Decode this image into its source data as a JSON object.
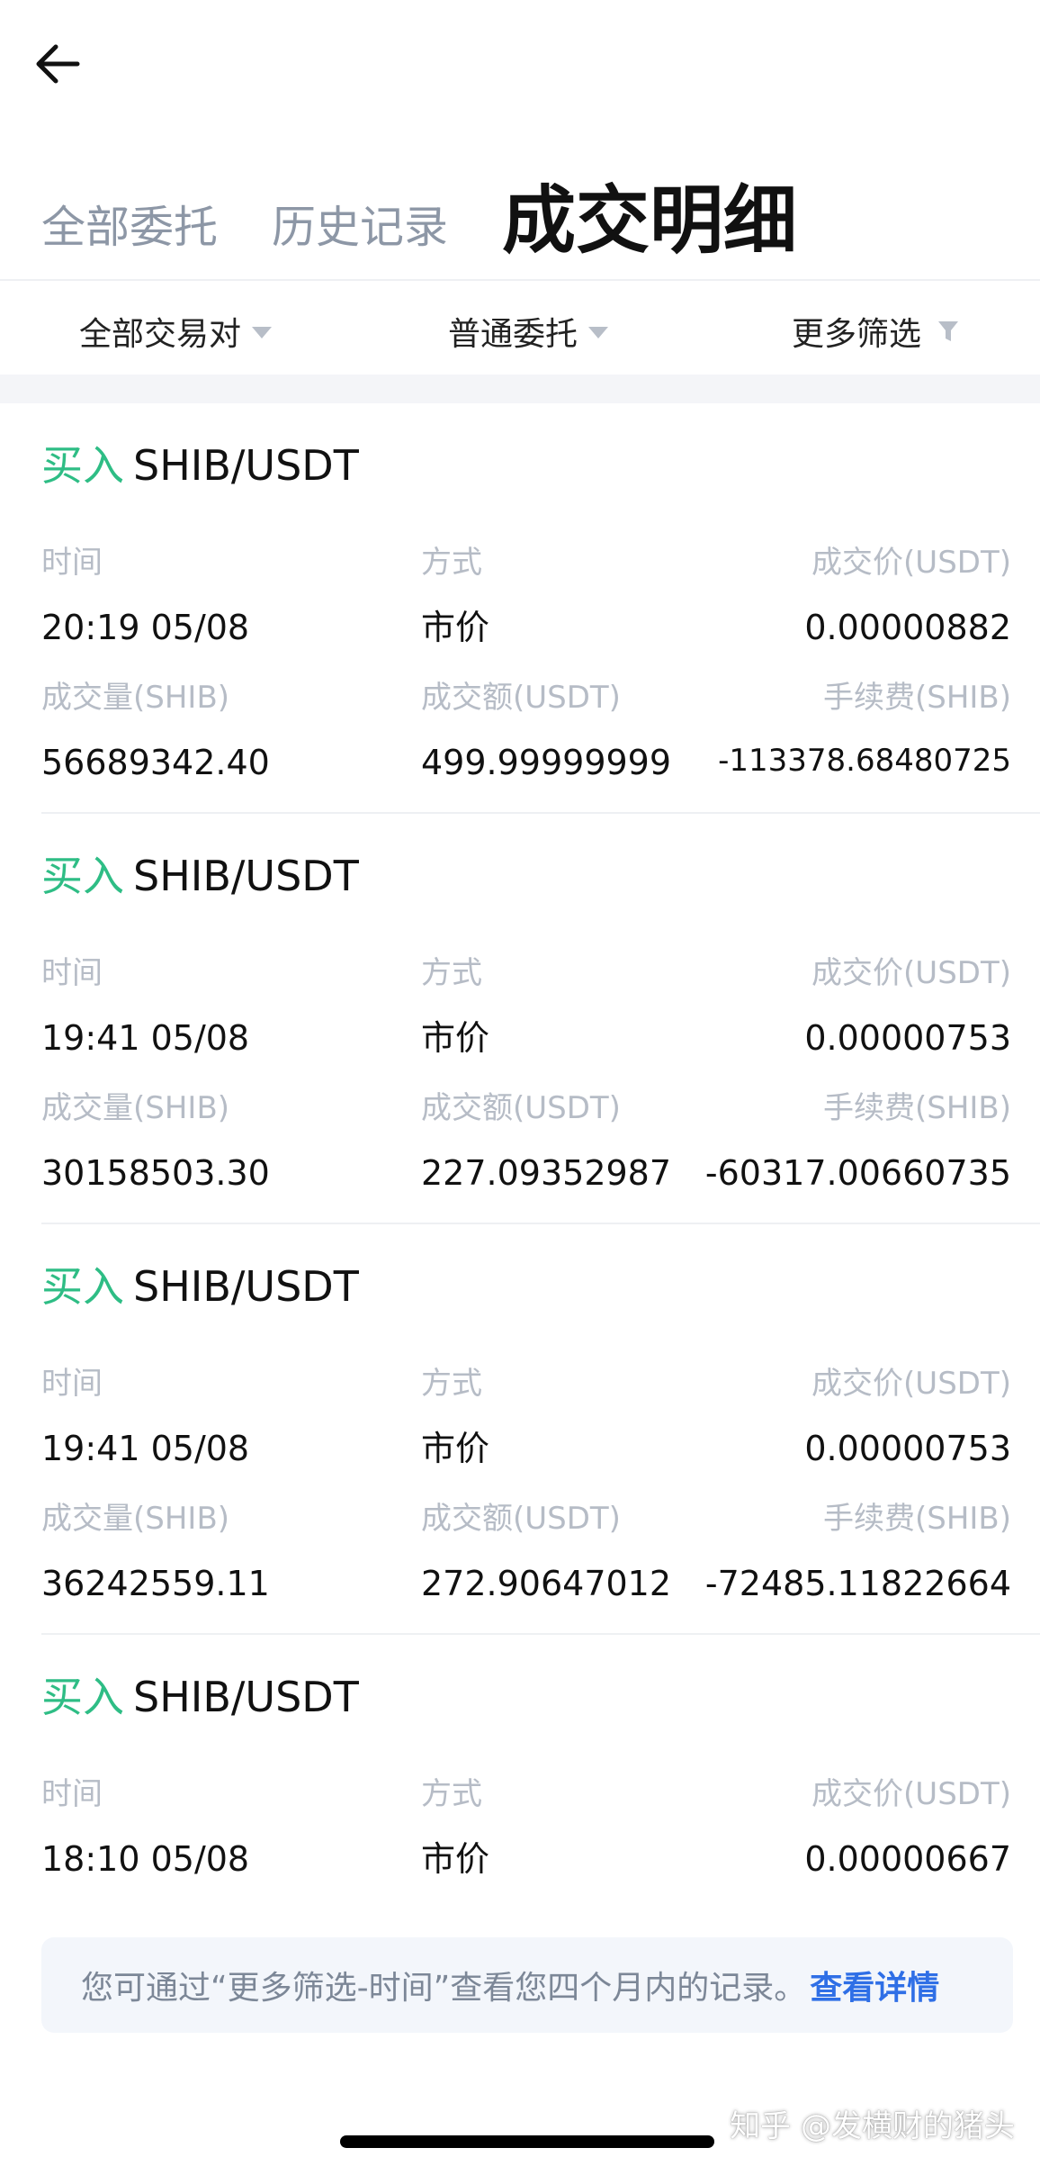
{
  "header": {
    "tabs": [
      {
        "label": "全部委托",
        "active": false
      },
      {
        "label": "历史记录",
        "active": false
      },
      {
        "label": "成交明细",
        "active": true
      }
    ]
  },
  "filters": {
    "pair": "全部交易对",
    "order_type": "普通委托",
    "more": "更多筛选"
  },
  "colors": {
    "buy": "#2ebd85",
    "link": "#2f6fe6",
    "label": "#b6bcc6"
  },
  "labels": {
    "time": "时间",
    "method": "方式",
    "price": "成交价(USDT)",
    "amount": "成交量(SHIB)",
    "total": "成交额(USDT)",
    "fee": "手续费(SHIB)"
  },
  "records": [
    {
      "side": "买入",
      "pair": "SHIB/USDT",
      "time": "20:19 05/08",
      "method": "市价",
      "price": "0.00000882",
      "amount": "56689342.40",
      "total": "499.99999999",
      "fee": "-113378.68480725"
    },
    {
      "side": "买入",
      "pair": "SHIB/USDT",
      "time": "19:41 05/08",
      "method": "市价",
      "price": "0.00000753",
      "amount": "30158503.30",
      "total": "227.09352987",
      "fee": "-60317.00660735"
    },
    {
      "side": "买入",
      "pair": "SHIB/USDT",
      "time": "19:41 05/08",
      "method": "市价",
      "price": "0.00000753",
      "amount": "36242559.11",
      "total": "272.90647012",
      "fee": "-72485.11822664"
    },
    {
      "side": "买入",
      "pair": "SHIB/USDT",
      "time": "18:10 05/08",
      "method": "市价",
      "price": "0.00000667"
    }
  ],
  "notice": {
    "text": "您可通过“更多筛选-时间”查看您四个月内的记录。",
    "link": "查看详情"
  },
  "watermark": "知乎 @发横财的猪头"
}
